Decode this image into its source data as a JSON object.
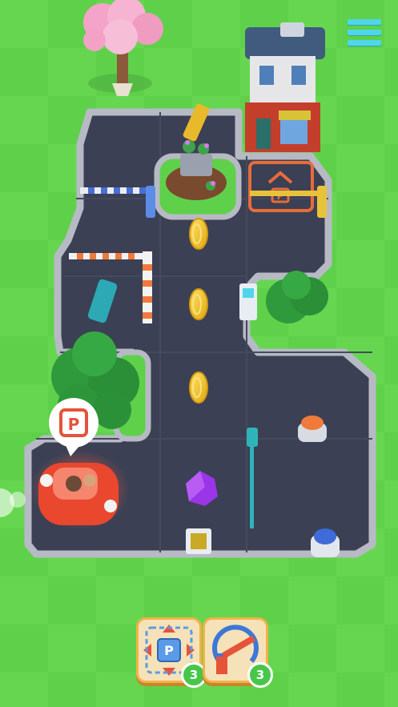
{
  "hud": {
    "menu_icon": "hamburger-menu-icon"
  },
  "powerups": [
    {
      "name": "move-parking-spot",
      "icon": "parking-arrows-icon",
      "count": "3"
    },
    {
      "name": "rotate-barrier",
      "icon": "rotate-barrier-icon",
      "count": "3"
    }
  ],
  "board": {
    "parking_sign_text": "P",
    "speech_bubble_icon": "parking-sign-icon",
    "coins": 3,
    "gem": "purple-gem"
  },
  "colors": {
    "grass": "#5fd04a",
    "road": "#3a3f52",
    "curb": "#b9bcc6",
    "accent_orange": "#f26a3d",
    "car": "#e9472e",
    "coin": "#f4c623",
    "gem": "#9b35e8",
    "menu": "#4fd6e8"
  }
}
